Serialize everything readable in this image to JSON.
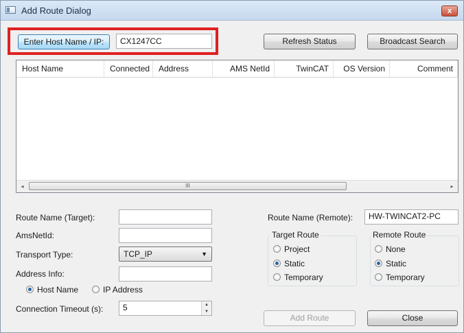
{
  "window": {
    "title": "Add Route Dialog",
    "close_label": "x"
  },
  "top": {
    "enter_host_label": "Enter Host Name / IP:",
    "host_value": "CX1247CC",
    "refresh_label": "Refresh Status",
    "broadcast_label": "Broadcast Search"
  },
  "table": {
    "columns": [
      "Host Name",
      "Connected",
      "Address",
      "AMS NetId",
      "TwinCAT",
      "OS Version",
      "Comment"
    ],
    "scroll_left": "◂",
    "scroll_right": "▸",
    "thumb_grip": "III"
  },
  "form": {
    "route_name_target_label": "Route Name (Target):",
    "route_name_target_value": "",
    "amsnetid_label": "AmsNetId:",
    "amsnetid_value": "",
    "transport_label": "Transport Type:",
    "transport_value": "TCP_IP",
    "address_info_label": "Address Info:",
    "address_info_value": "",
    "host_name_radio": "Host Name",
    "ip_address_radio": "IP Address",
    "timeout_label": "Connection Timeout (s):",
    "timeout_value": "5"
  },
  "remote": {
    "route_name_remote_label": "Route Name (Remote):",
    "route_name_remote_value": "HW-TWINCAT2-PC",
    "target_route_title": "Target Route",
    "target_options": [
      "Project",
      "Static",
      "Temporary"
    ],
    "target_selected": "Static",
    "remote_route_title": "Remote Route",
    "remote_options": [
      "None",
      "Static",
      "Temporary"
    ],
    "remote_selected": "Static"
  },
  "buttons": {
    "add_route": "Add Route",
    "close": "Close"
  },
  "colors": {
    "highlight": "#e02020",
    "titlebar": "#c6d9ef"
  }
}
